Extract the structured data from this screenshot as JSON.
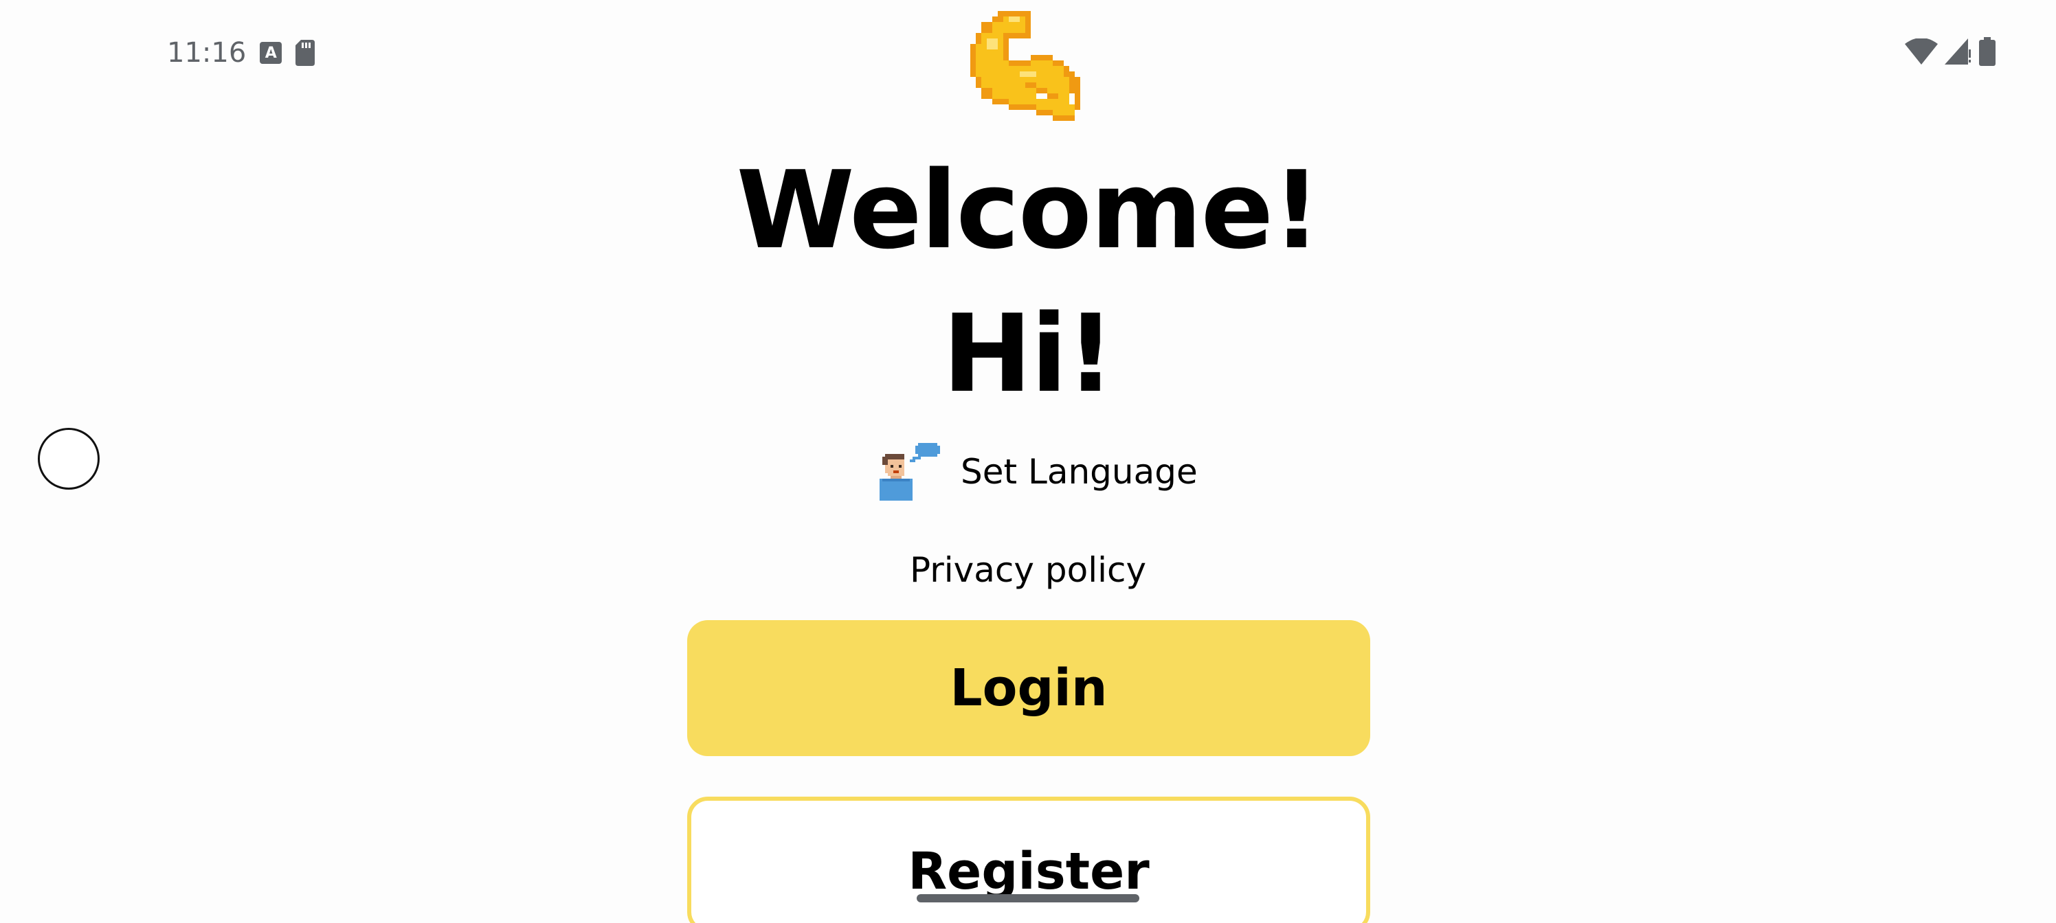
{
  "status_bar": {
    "time": "11:16",
    "keyboard_icon_letter": "A",
    "icons_left": [
      "keyboard-icon",
      "sd-card-icon"
    ],
    "icons_right": [
      "wifi-icon",
      "cell-signal-icon",
      "battery-icon"
    ]
  },
  "logo": {
    "icon": "flexed-biceps-icon",
    "colors": {
      "primary": "#F9C21B",
      "outline": "#F09A12"
    }
  },
  "welcome": {
    "title": "Welcome!",
    "subtitle": "Hi!"
  },
  "language": {
    "icon": "speaking-person-icon",
    "label": "Set Language"
  },
  "privacy": {
    "label": "Privacy policy"
  },
  "buttons": {
    "login_label": "Login",
    "register_label": "Register"
  },
  "colors": {
    "accent": "#F8DC5E",
    "background": "#FDFDFD",
    "text": "#000000"
  }
}
